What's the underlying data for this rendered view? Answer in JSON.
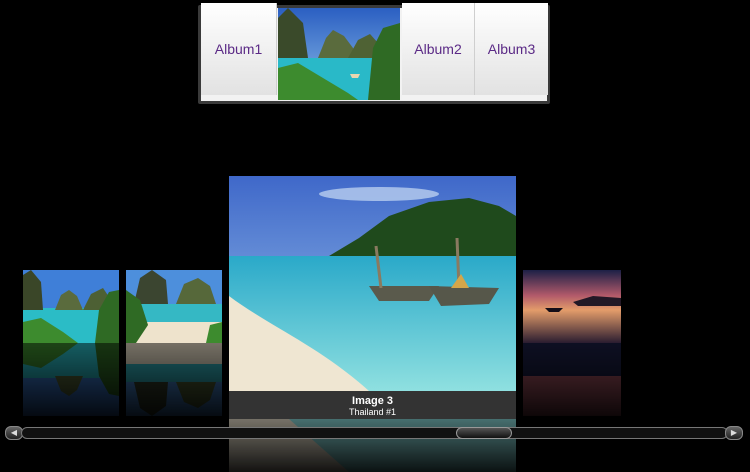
{
  "albums": [
    {
      "label": "Album1"
    },
    {
      "label": "Album2"
    },
    {
      "label": "Album3"
    }
  ],
  "selected_image": {
    "title": "Image 3",
    "subtitle": "Thailand #1"
  },
  "scrollbar": {
    "left_icon": "chevron-left-icon",
    "right_icon": "chevron-right-icon",
    "left_glyph": "◀",
    "right_glyph": "▶"
  },
  "colors": {
    "background": "#000000",
    "album_text": "#5b2a86"
  }
}
